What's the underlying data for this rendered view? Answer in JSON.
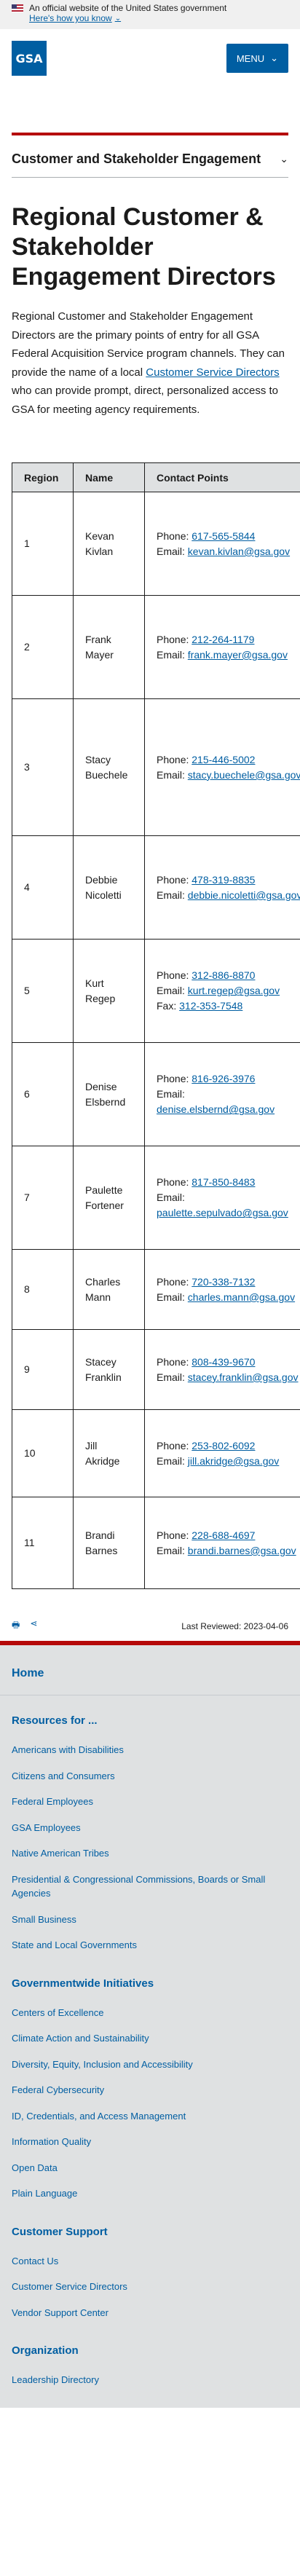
{
  "gov_banner": {
    "text": "An official website of the United States government",
    "link": "Here's how you know"
  },
  "header": {
    "logo": "GSA",
    "menu": "MENU"
  },
  "section_nav": {
    "title": "Customer and Stakeholder Engagement"
  },
  "page": {
    "title": "Regional Customer & Stakeholder Engagement Directors",
    "intro_before": "Regional Customer and Stakeholder Engagement Directors are the primary points of entry for all GSA Federal Acquisition Service program channels. They can provide the name of a local ",
    "intro_link": "Customer Service Directors",
    "intro_after": " who can provide prompt, direct, personalized access to GSA for meeting agency requirements."
  },
  "table": {
    "headers": [
      "Region",
      "Name",
      "Contact Points"
    ],
    "phone_label": "Phone:",
    "email_label": "Email:",
    "fax_label": "Fax:",
    "rows": [
      {
        "region": "1",
        "name": "Kevan Kivlan",
        "phone": "617-565-5844",
        "email": "kevan.kivlan@gsa.gov",
        "fax": null
      },
      {
        "region": "2",
        "name": "Frank Mayer",
        "phone": "212-264-1179",
        "email": "frank.mayer@gsa.gov",
        "fax": null
      },
      {
        "region": "3",
        "name": "Stacy Buechele",
        "phone": "215-446-5002",
        "email": "stacy.buechele@gsa.gov",
        "fax": null
      },
      {
        "region": "4",
        "name": "Debbie Nicoletti",
        "phone": "478-319-8835",
        "email": "debbie.nicoletti@gsa.gov",
        "fax": null
      },
      {
        "region": "5",
        "name": "Kurt Regep",
        "phone": "312-886-8870",
        "email": "kurt.regep@gsa.gov",
        "fax": "312-353-7548"
      },
      {
        "region": "6",
        "name": "Denise Elsbernd",
        "phone": "816-926-3976",
        "email": "denise.elsbernd@gsa.gov",
        "fax": null
      },
      {
        "region": "7",
        "name": "Paulette Fortener",
        "phone": "817-850-8483",
        "email": "paulette.sepulvado@gsa.gov",
        "fax": null
      },
      {
        "region": "8",
        "name": "Charles Mann",
        "phone": "720-338-7132",
        "email": "charles.mann@gsa.gov",
        "fax": null
      },
      {
        "region": "9",
        "name": "Stacey Franklin",
        "phone": "808-439-9670",
        "email": "stacey.franklin@gsa.gov",
        "fax": null
      },
      {
        "region": "10",
        "name": "Jill Akridge",
        "phone": "253-802-6092",
        "email": "jill.akridge@gsa.gov",
        "fax": null
      },
      {
        "region": "11",
        "name": "Brandi Barnes",
        "phone": "228-688-4697",
        "email": "brandi.barnes@gsa.gov",
        "fax": null
      }
    ]
  },
  "last_reviewed": "Last Reviewed: 2023-04-06",
  "footer": {
    "home": "Home",
    "sections": [
      {
        "title": "Resources for ...",
        "links": [
          "Americans with Disabilities",
          "Citizens and Consumers",
          "Federal Employees",
          "GSA Employees",
          "Native American Tribes",
          "Presidential & Congressional Commissions, Boards or Small Agencies",
          "Small Business",
          "State and Local Governments"
        ]
      },
      {
        "title": "Governmentwide Initiatives",
        "links": [
          "Centers of Excellence",
          "Climate Action and Sustainability",
          "Diversity, Equity, Inclusion and Accessibility",
          "Federal Cybersecurity",
          "ID, Credentials, and Access Management",
          "Information Quality",
          "Open Data",
          "Plain Language"
        ]
      },
      {
        "title": "Customer Support",
        "links": [
          "Contact Us",
          "Customer Service Directors",
          "Vendor Support Center"
        ]
      },
      {
        "title": "Organization",
        "links": [
          "Leadership Directory"
        ]
      }
    ]
  }
}
